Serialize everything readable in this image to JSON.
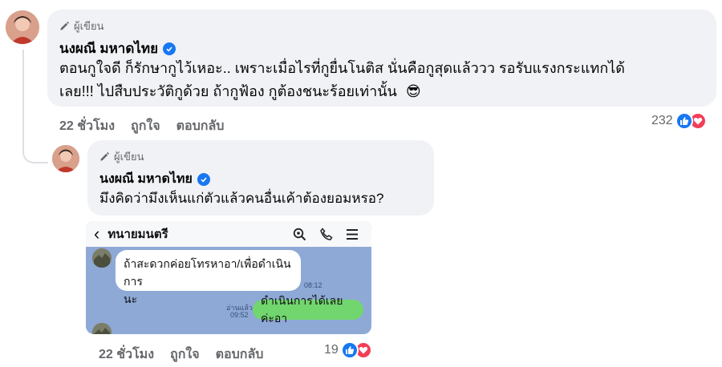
{
  "comment": {
    "author_badge": "ผู้เขียน",
    "author": "นงผณี มหาดไทย",
    "text_line1": "ตอนกูใจดี ก็รักษากูไว้เหอะ.. เพราะเมื่อไรที่กูยื่นโนติส นั่นคือกูสุดแล้ววว รอรับแรงกระแทกได้",
    "text_line2": "เลย!!! ไปสืบประวัติกูด้วย ถ้ากูฟ้อง กูต้องชนะร้อยเท่านั้น",
    "emoji": "😎",
    "time": "22 ชั่วโมง",
    "like_label": "ถูกใจ",
    "reply_label": "ตอบกลับ",
    "reaction_count": "232"
  },
  "reply": {
    "author_badge": "ผู้เขียน",
    "author": "นงผณี มหาดไทย",
    "text": "มึงคิดว่ามึงเห็นแก่ตัวแล้วคนอื่นเค้าต้องยอมหรอ?",
    "time": "22 ชั่วโมง",
    "like_label": "ถูกใจ",
    "reply_label": "ตอบกลับ",
    "reaction_count": "19",
    "attachment": {
      "chat_title": "ทนายมนตรี",
      "back_glyph": "‹",
      "msg_in_line1": "ถ้าสะดวกค่อยโทรหาอา/เพื่อดำเนินการ",
      "msg_in_line2": "นะ",
      "msg_in_time": "08:12",
      "msg_out": "ดำเนินการได้เลยค่ะอา",
      "read_label": "อ่านแล้ว",
      "msg_out_time": "09:52"
    }
  },
  "icons": {
    "pencil": "pencil-icon",
    "verified": "verified-badge-icon",
    "like": "like-reaction-icon",
    "love": "love-reaction-icon",
    "search": "search-icon",
    "phone": "phone-icon",
    "menu": "menu-icon"
  },
  "colors": {
    "accent": "#1877f2",
    "love": "#f33e58",
    "bubble": "#f0f2f5",
    "chat_bg": "#8ea9d6",
    "chat_out": "#71d66d"
  }
}
